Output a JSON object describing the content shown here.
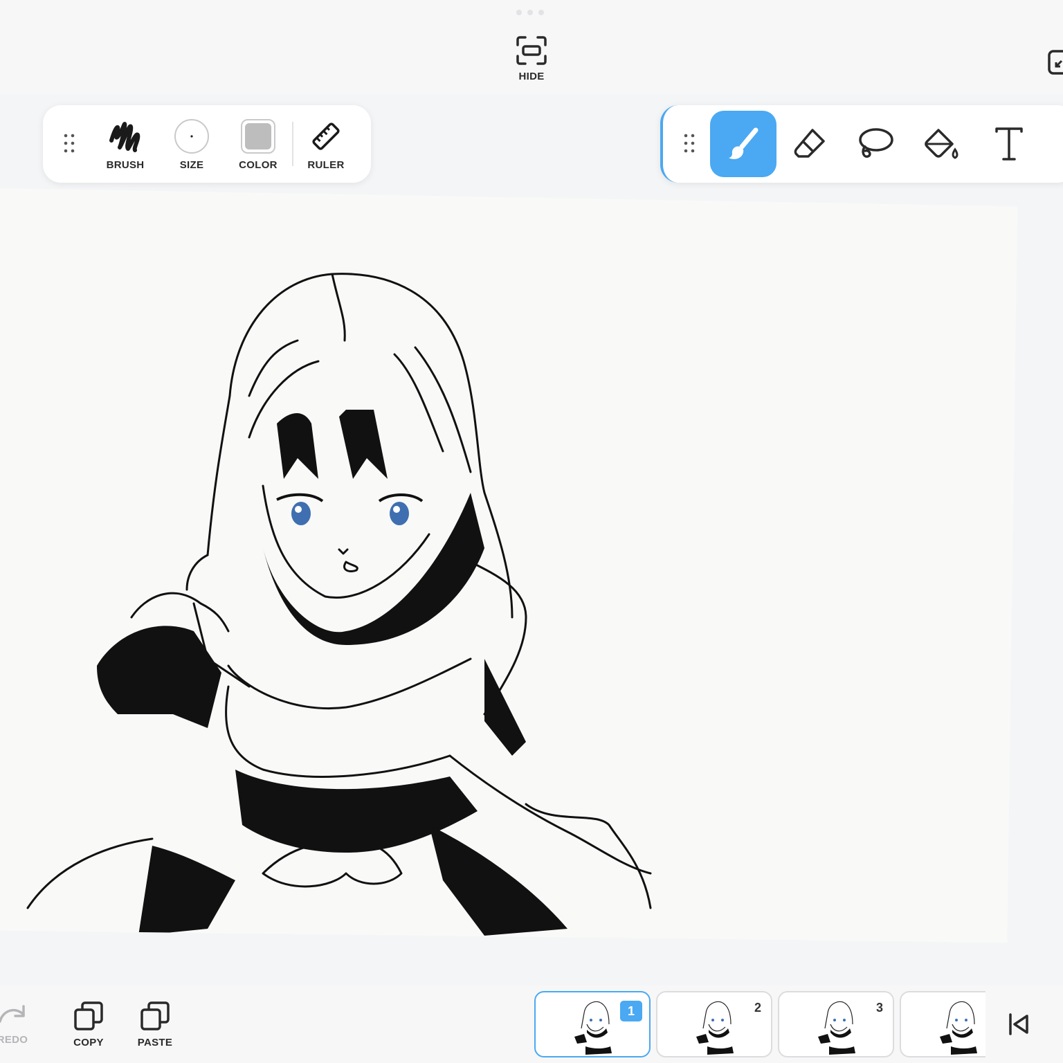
{
  "top_bar": {
    "hide_label": "HIDE"
  },
  "left_toolbar": {
    "brush_label": "BRUSH",
    "size_label": "SIZE",
    "color_label": "COLOR",
    "ruler_label": "RULER",
    "selected_color": "#bdbdbd"
  },
  "right_toolbar": {
    "tools": [
      {
        "name": "brush-tool",
        "icon": "paintbrush-icon",
        "active": true
      },
      {
        "name": "eraser-tool",
        "icon": "eraser-icon",
        "active": false
      },
      {
        "name": "lasso-tool",
        "icon": "lasso-icon",
        "active": false
      },
      {
        "name": "fill-tool",
        "icon": "paint-bucket-icon",
        "active": false
      },
      {
        "name": "text-tool",
        "icon": "text-icon",
        "active": false
      }
    ],
    "accent_color": "#4aa9f2"
  },
  "bottom_bar": {
    "redo_label": "REDO",
    "copy_label": "COPY",
    "paste_label": "PASTE"
  },
  "frames": [
    {
      "number": "1",
      "active": true
    },
    {
      "number": "2",
      "active": false
    },
    {
      "number": "3",
      "active": false
    },
    {
      "number": "",
      "active": false
    }
  ]
}
